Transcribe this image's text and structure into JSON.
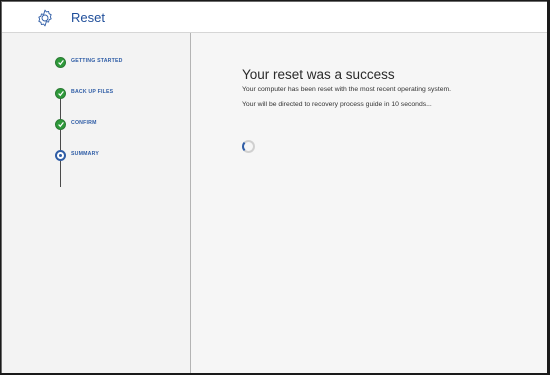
{
  "header": {
    "title": "Reset",
    "icon": "gear-icon"
  },
  "steps": [
    {
      "label": "GETTING STARTED",
      "status": "done"
    },
    {
      "label": "BACK UP FILES",
      "status": "done"
    },
    {
      "label": "CONFIRM",
      "status": "done"
    },
    {
      "label": "SUMMARY",
      "status": "current"
    }
  ],
  "main": {
    "title": "Your reset was a success",
    "line1": "Your computer has been reset with the most recent operating system.",
    "line2": "Your will be directed to recovery process guide in 10 seconds..."
  },
  "colors": {
    "accent": "#2f5da6",
    "done": "#2e9a3a"
  }
}
